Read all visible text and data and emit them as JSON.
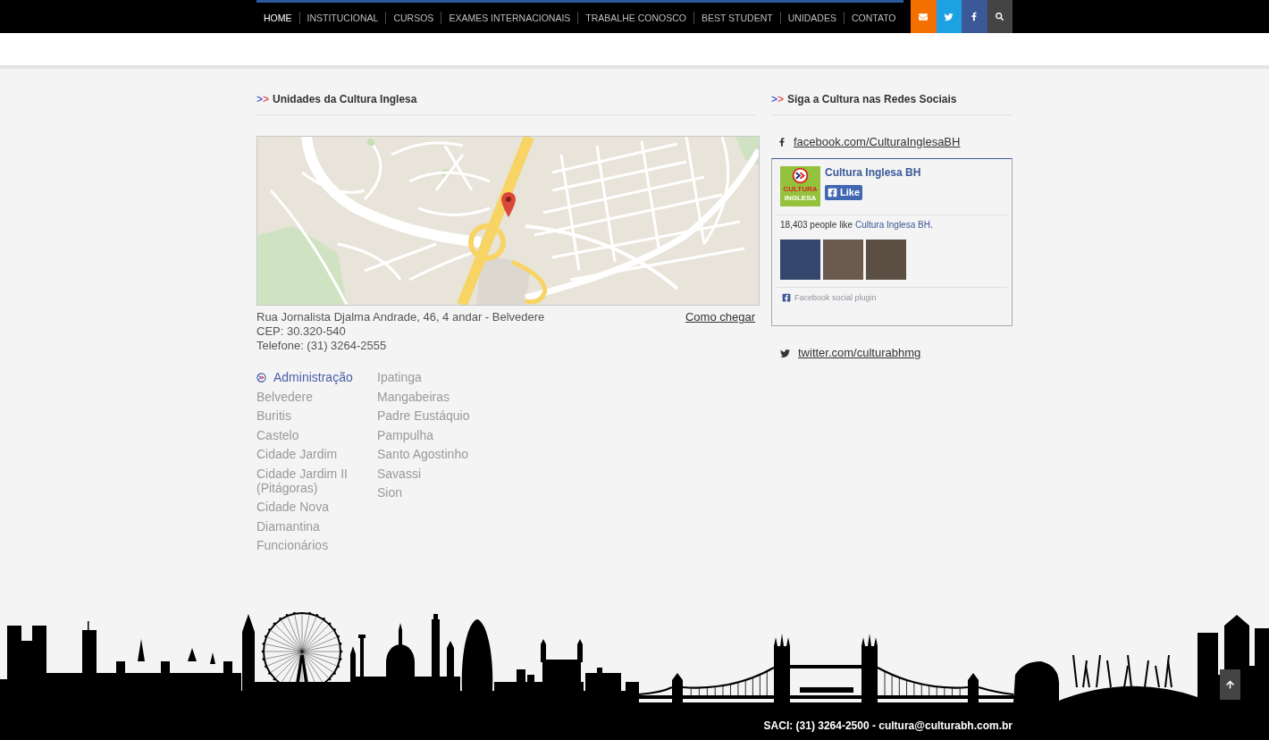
{
  "nav": {
    "items": [
      {
        "label": "HOME",
        "selected": true
      },
      {
        "label": "INSTITUCIONAL",
        "selected": false
      },
      {
        "label": "CURSOS",
        "selected": false
      },
      {
        "label": "EXAMES INTERNACIONAIS",
        "selected": false
      },
      {
        "label": "TRABALHE CONOSCO",
        "selected": false
      },
      {
        "label": "BEST STUDENT",
        "selected": false
      },
      {
        "label": "UNIDADES",
        "selected": false
      },
      {
        "label": "CONTATO",
        "selected": false
      }
    ],
    "social": [
      {
        "kind": "mail",
        "color": "#f36f00"
      },
      {
        "kind": "twitter",
        "color": "#1da1e3"
      },
      {
        "kind": "facebook",
        "color": "#3b5998"
      },
      {
        "kind": "search",
        "color": "#444444"
      }
    ]
  },
  "units_section": {
    "marker": ">>",
    "title": "Unidades da Cultura Inglesa",
    "address": "Rua Jornalista Djalma Andrade, 46, 4 andar - Belvedere",
    "directions_link": "Como chegar",
    "cep": "CEP: 30.320-540",
    "phone": "Telefone: (31) 3264-2555",
    "units": [
      {
        "items": [
          {
            "label": "Administração",
            "selected": true
          },
          {
            "label": "Belvedere",
            "selected": false
          },
          {
            "label": "Buritis",
            "selected": false
          },
          {
            "label": "Castelo",
            "selected": false
          },
          {
            "label": "Cidade Jardim",
            "selected": false
          },
          {
            "label": "Cidade Jardim II (Pitágoras)",
            "selected": false
          },
          {
            "label": "Cidade Nova",
            "selected": false
          },
          {
            "label": "Diamantina",
            "selected": false
          },
          {
            "label": "Funcionários",
            "selected": false
          }
        ]
      },
      {
        "items": [
          {
            "label": "Ipatinga",
            "selected": false
          },
          {
            "label": "Mangabeiras",
            "selected": false
          },
          {
            "label": "Padre Eustáquio",
            "selected": false
          },
          {
            "label": "Pampulha",
            "selected": false
          },
          {
            "label": "Santo Agostinho",
            "selected": false
          },
          {
            "label": "Savassi",
            "selected": false
          },
          {
            "label": "Sion",
            "selected": false
          }
        ]
      }
    ]
  },
  "social_section": {
    "marker": ">>",
    "title": "Siga a Cultura nas Redes Sociais",
    "facebook_link": "facebook.com/CulturaInglesaBH",
    "facebook_widget": {
      "logo": {
        "line_1": "CULTURA",
        "line_2": "INGLESA"
      },
      "page_name": "Cultura Inglesa BH",
      "like_button": "Like",
      "likes_text": "18,403 people like",
      "likes_link": "Cultura Inglesa BH",
      "likes_end": ".",
      "plugin_label": "Facebook social plugin"
    },
    "twitter_link": "twitter.com/culturabhmg"
  },
  "footer": {
    "contact": "SACI: (31) 3264-2500 - cultura@culturabh.com.br"
  }
}
